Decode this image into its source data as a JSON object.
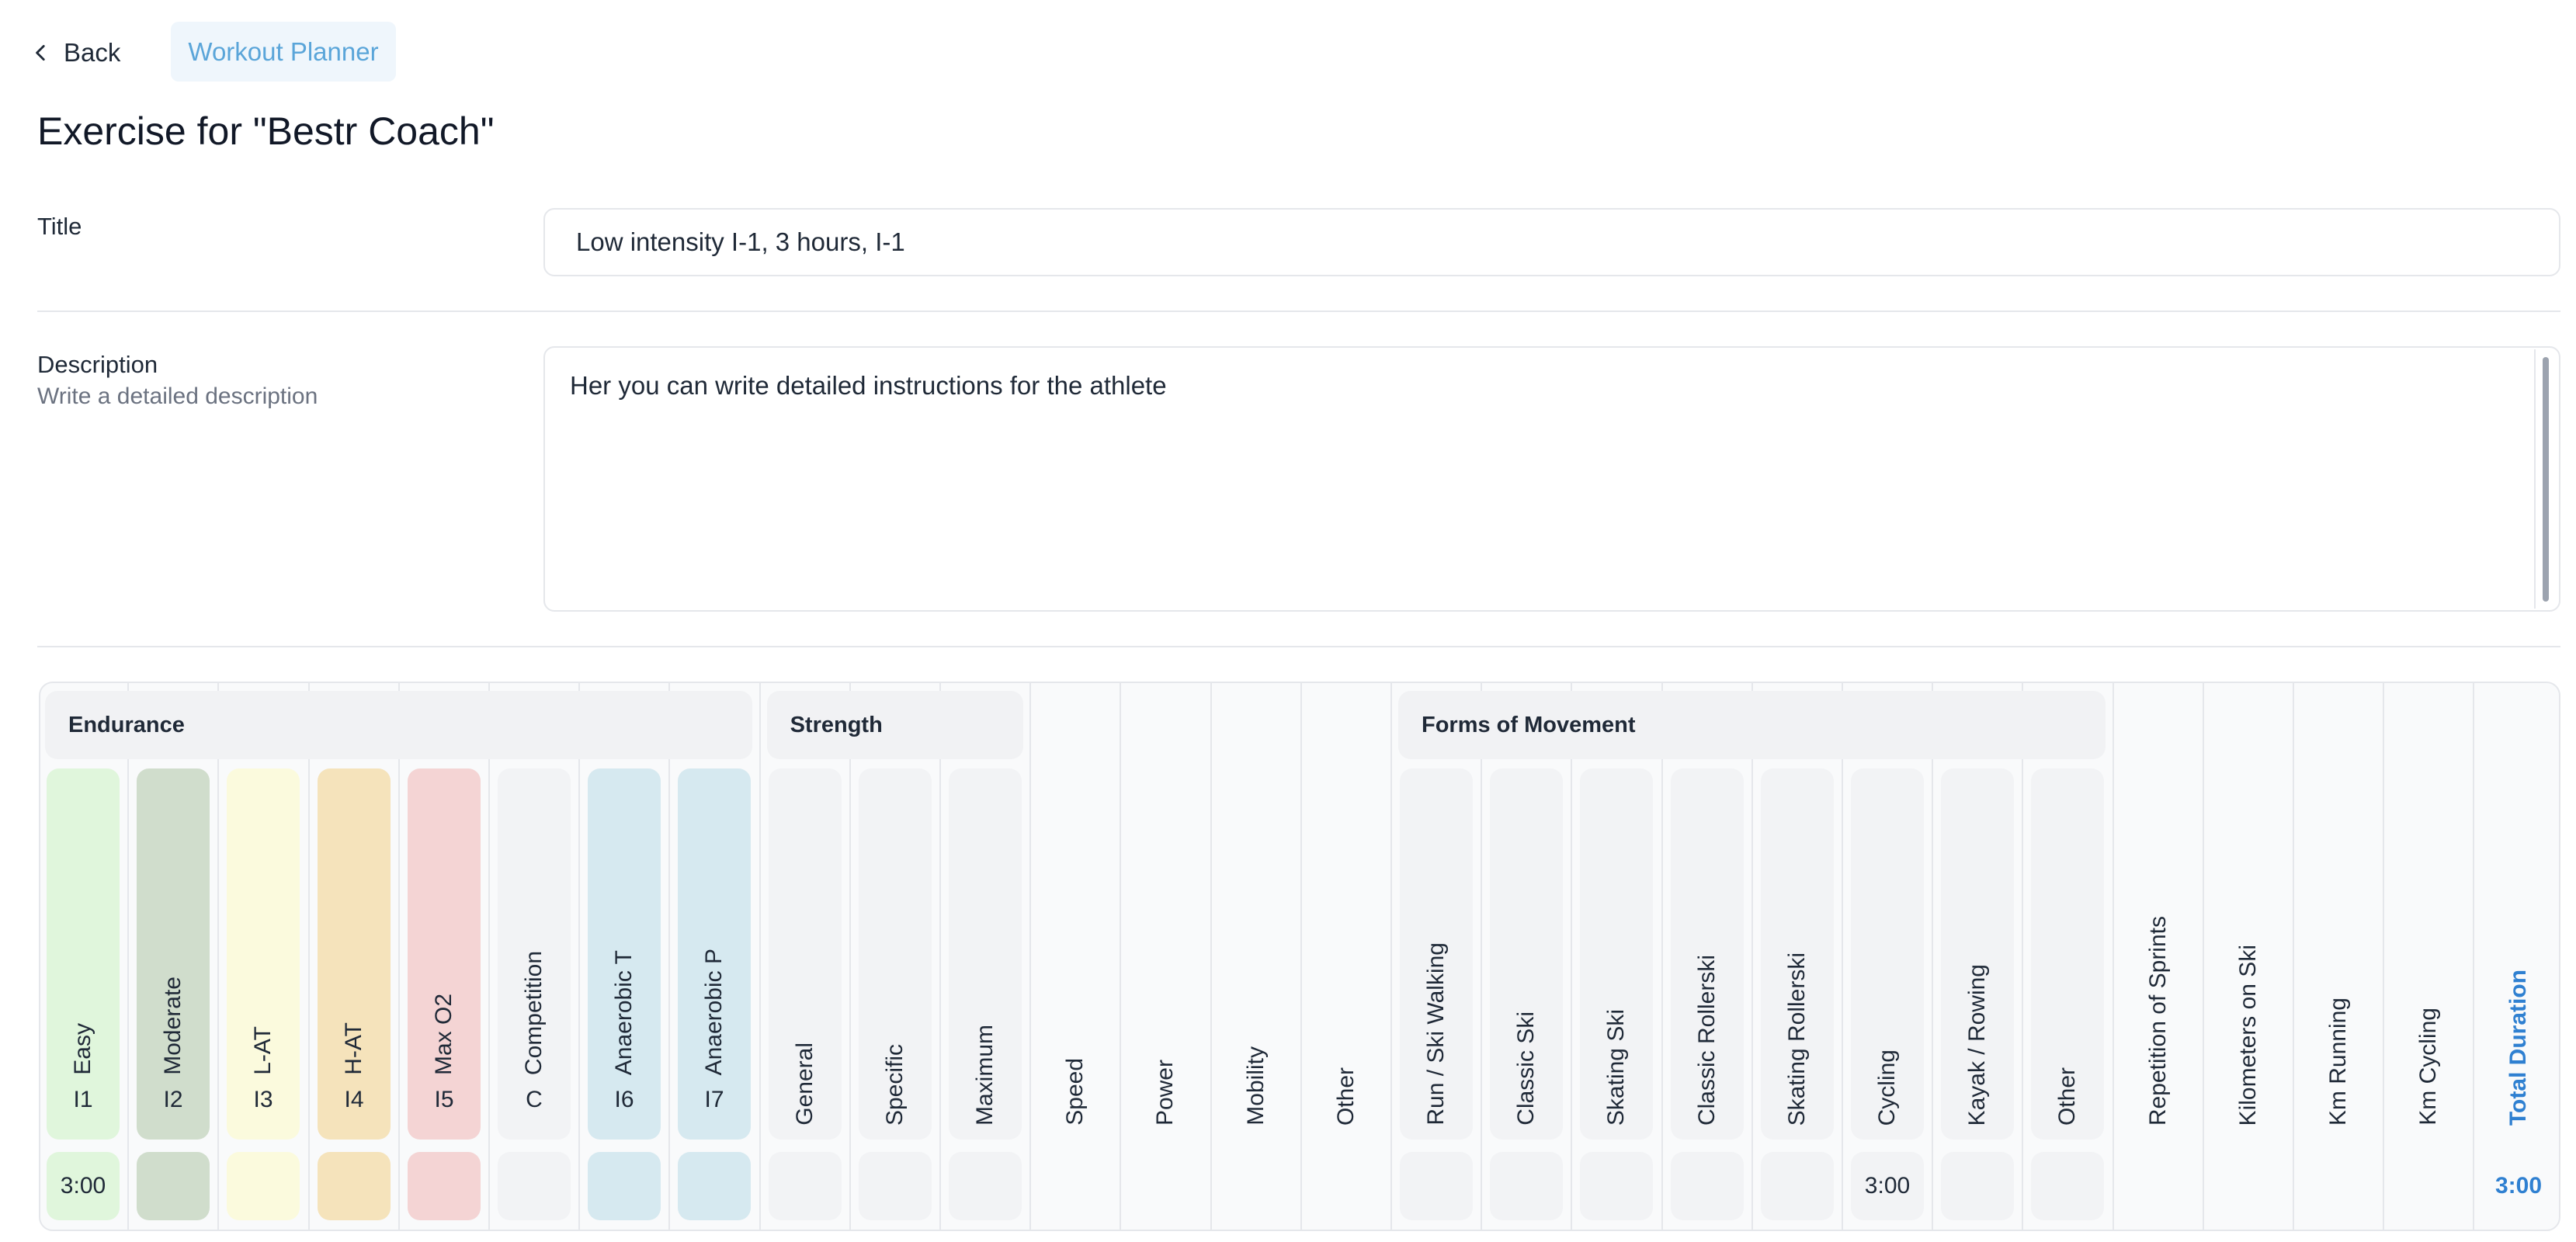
{
  "nav": {
    "back_label": "Back",
    "breadcrumb": "Workout Planner"
  },
  "page": {
    "title": "Exercise for \"Bestr Coach\""
  },
  "form": {
    "title_label": "Title",
    "title_value": "Low intensity I-1, 3 hours, I-1",
    "description_label": "Description",
    "description_hint": "Write a detailed description",
    "description_value": "Her you can write detailed instructions for the athlete"
  },
  "grid": {
    "groups": {
      "endurance": "Endurance",
      "strength": "Strength",
      "forms_of_movement": "Forms of Movement"
    },
    "columns": [
      {
        "label": "Easy",
        "code": "I1",
        "value": "3:00",
        "color": "#e0f6dc"
      },
      {
        "label": "Moderate",
        "code": "I2",
        "value": "",
        "color": "#d0ddcc"
      },
      {
        "label": "L-AT",
        "code": "I3",
        "value": "",
        "color": "#fbfadd"
      },
      {
        "label": "H-AT",
        "code": "I4",
        "value": "",
        "color": "#f5e3bb"
      },
      {
        "label": "Max O2",
        "code": "I5",
        "value": "",
        "color": "#f4d4d4"
      },
      {
        "label": "Competition",
        "code": "C",
        "value": "",
        "color": "#f2f3f5"
      },
      {
        "label": "Anaerobic T",
        "code": "I6",
        "value": "",
        "color": "#d6e9f0"
      },
      {
        "label": "Anaerobic P",
        "code": "I7",
        "value": "",
        "color": "#d6e9f0"
      },
      {
        "label": "General",
        "code": "",
        "value": "",
        "color": "#f2f3f5"
      },
      {
        "label": "Specific",
        "code": "",
        "value": "",
        "color": "#f2f3f5"
      },
      {
        "label": "Maximum",
        "code": "",
        "value": "",
        "color": "#f2f3f5"
      },
      {
        "label": "Speed",
        "code": "",
        "value": "",
        "color": ""
      },
      {
        "label": "Power",
        "code": "",
        "value": "",
        "color": ""
      },
      {
        "label": "Mobility",
        "code": "",
        "value": "",
        "color": ""
      },
      {
        "label": "Other",
        "code": "",
        "value": "",
        "color": ""
      },
      {
        "label": "Run / Ski Walking",
        "code": "",
        "value": "",
        "color": "#f2f3f5"
      },
      {
        "label": "Classic Ski",
        "code": "",
        "value": "",
        "color": "#f2f3f5"
      },
      {
        "label": "Skating Ski",
        "code": "",
        "value": "",
        "color": "#f2f3f5"
      },
      {
        "label": "Classic Rollerski",
        "code": "",
        "value": "",
        "color": "#f2f3f5"
      },
      {
        "label": "Skating Rollerski",
        "code": "",
        "value": "",
        "color": "#f2f3f5"
      },
      {
        "label": "Cycling",
        "code": "",
        "value": "3:00",
        "color": "#f2f3f5"
      },
      {
        "label": "Kayak / Rowing",
        "code": "",
        "value": "",
        "color": "#f2f3f5"
      },
      {
        "label": "Other",
        "code": "",
        "value": "",
        "color": "#f2f3f5"
      },
      {
        "label": "Repetition of Sprints",
        "code": "",
        "value": "",
        "color": ""
      },
      {
        "label": "Kilometers on Ski",
        "code": "",
        "value": "",
        "color": ""
      },
      {
        "label": "Km Running",
        "code": "",
        "value": "",
        "color": ""
      },
      {
        "label": "Km Cycling",
        "code": "",
        "value": "",
        "color": ""
      },
      {
        "label": "Total Duration",
        "code": "",
        "value": "3:00",
        "color": ""
      }
    ]
  }
}
